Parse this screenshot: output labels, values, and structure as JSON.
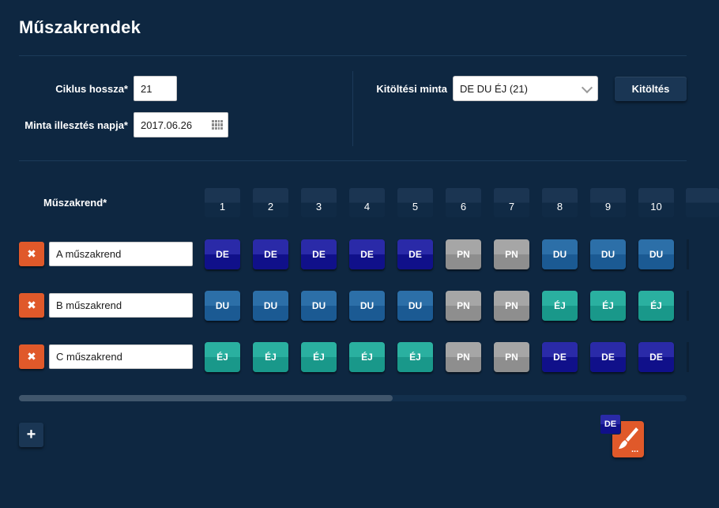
{
  "title": "Műszakrendek",
  "form": {
    "cycle_length_label": "Ciklus hossza*",
    "cycle_length_value": "21",
    "pattern_date_label": "Minta illesztés napja*",
    "pattern_date_value": "2017.06.26",
    "fill_pattern_label": "Kitöltési minta",
    "fill_pattern_value": "DE DU ÉJ (21)",
    "fill_button_label": "Kitöltés"
  },
  "grid": {
    "shift_label": "Műszakrend*",
    "days": [
      "1",
      "2",
      "3",
      "4",
      "5",
      "6",
      "7",
      "8",
      "9",
      "10"
    ],
    "rows": [
      {
        "name": "A műszakrend",
        "delete_icon": "✖",
        "cells": [
          "DE",
          "DE",
          "DE",
          "DE",
          "DE",
          "PN",
          "PN",
          "DU",
          "DU",
          "DU"
        ]
      },
      {
        "name": "B műszakrend",
        "delete_icon": "✖",
        "cells": [
          "DU",
          "DU",
          "DU",
          "DU",
          "DU",
          "PN",
          "PN",
          "ÉJ",
          "ÉJ",
          "ÉJ"
        ]
      },
      {
        "name": "C műszakrend",
        "delete_icon": "✖",
        "cells": [
          "ÉJ",
          "ÉJ",
          "ÉJ",
          "ÉJ",
          "ÉJ",
          "PN",
          "PN",
          "DE",
          "DE",
          "DE"
        ]
      }
    ]
  },
  "footer": {
    "add_icon": "+",
    "brush_badge": "DE",
    "brush_dots": "..."
  },
  "colors": {
    "background": "#0e2741",
    "delete": "#e0592a",
    "DE": "#10108a",
    "DU": "#1b5a93",
    "EJ": "#19988a",
    "PN": "#8e8e8e"
  },
  "icons": {
    "date_picker": "calendar-icon",
    "select": "chevron-down-icon",
    "delete": "close-icon",
    "add": "plus-icon",
    "paint": "paintbrush-icon"
  }
}
